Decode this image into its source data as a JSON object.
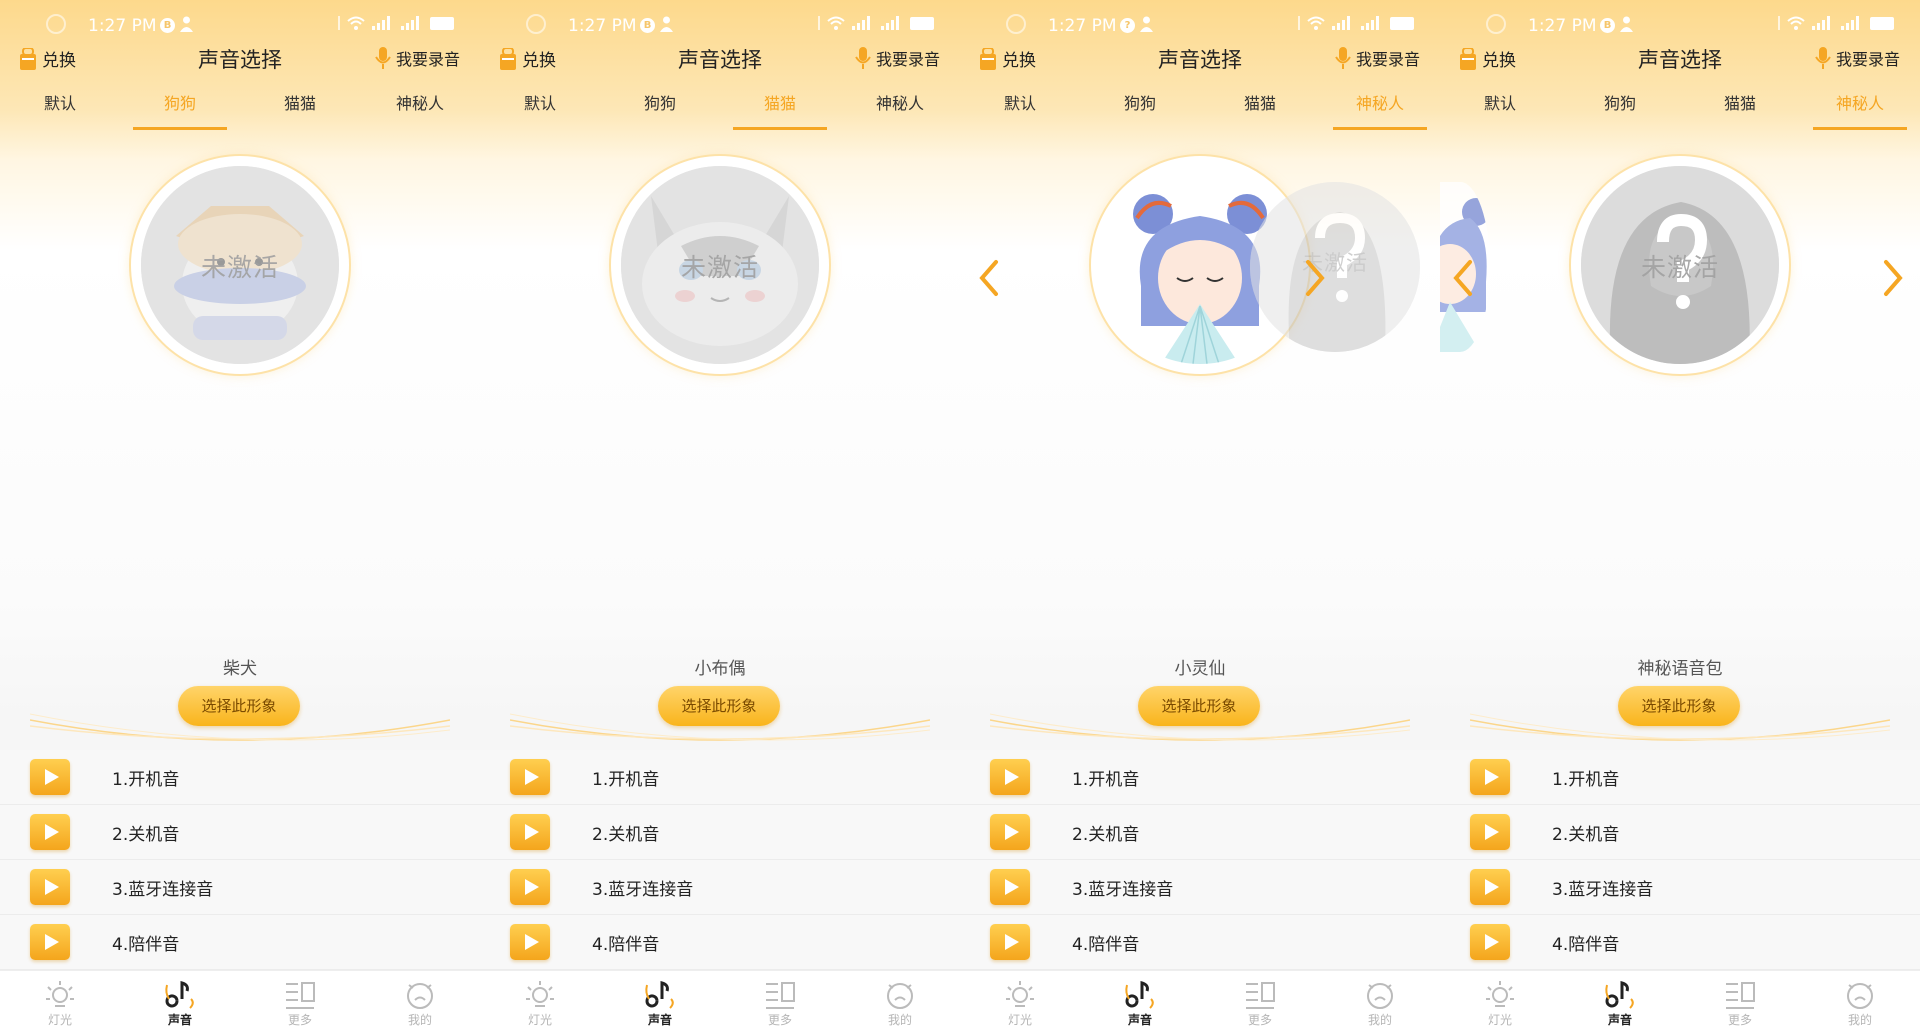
{
  "colors": {
    "accent": "#f5a623",
    "header_top": "#fdd98c",
    "button": "#f9b41b"
  },
  "screens": [
    {
      "status": {
        "time": "1:27 PM",
        "notif": "B"
      },
      "header": {
        "exchange": "兑换",
        "title": "声音选择",
        "record": "我要录音"
      },
      "tabs": [
        "默认",
        "狗狗",
        "猫猫",
        "神秘人"
      ],
      "active_tab": 1,
      "avatar_icon": "shiba-dog-avatar",
      "avatar_status": "未激活",
      "character_name": "柴犬",
      "select_label": "选择此形象",
      "sounds": [
        "1.开机音",
        "2.关机音",
        "3.蓝牙连接音",
        "4.陪伴音"
      ],
      "nav": [
        "灯光",
        "声音",
        "更多",
        "我的"
      ],
      "active_nav": 1
    },
    {
      "status": {
        "time": "1:27 PM",
        "notif": "B"
      },
      "header": {
        "exchange": "兑换",
        "title": "声音选择",
        "record": "我要录音"
      },
      "tabs": [
        "默认",
        "狗狗",
        "猫猫",
        "神秘人"
      ],
      "active_tab": 2,
      "avatar_icon": "ragdoll-cat-avatar",
      "avatar_status": "未激活",
      "character_name": "小布偶",
      "select_label": "选择此形象",
      "sounds": [
        "1.开机音",
        "2.关机音",
        "3.蓝牙连接音",
        "4.陪伴音"
      ],
      "nav": [
        "灯光",
        "声音",
        "更多",
        "我的"
      ],
      "active_nav": 1
    },
    {
      "status": {
        "time": "1:27 PM",
        "notif": "?"
      },
      "header": {
        "exchange": "兑换",
        "title": "声音选择",
        "record": "我要录音"
      },
      "tabs": [
        "默认",
        "狗狗",
        "猫猫",
        "神秘人"
      ],
      "active_tab": 3,
      "avatar_icon": "fairy-girl-avatar",
      "character_name": "小灵仙",
      "side_status": "未激活",
      "select_label": "选择此形象",
      "sounds": [
        "1.开机音",
        "2.关机音",
        "3.蓝牙连接音",
        "4.陪伴音"
      ],
      "nav": [
        "灯光",
        "声音",
        "更多",
        "我的"
      ],
      "active_nav": 1
    },
    {
      "status": {
        "time": "1:27 PM",
        "notif": "B"
      },
      "header": {
        "exchange": "兑换",
        "title": "声音选择",
        "record": "我要录音"
      },
      "tabs": [
        "默认",
        "狗狗",
        "猫猫",
        "神秘人"
      ],
      "active_tab": 3,
      "avatar_icon": "mystery-silhouette-avatar",
      "avatar_status": "未激活",
      "character_name": "神秘语音包",
      "select_label": "选择此形象",
      "sounds": [
        "1.开机音",
        "2.关机音",
        "3.蓝牙连接音",
        "4.陪伴音"
      ],
      "nav": [
        "灯光",
        "声音",
        "更多",
        "我的"
      ],
      "active_nav": 1
    }
  ]
}
